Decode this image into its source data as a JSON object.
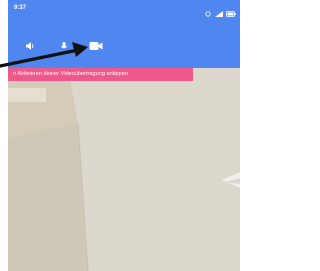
{
  "status_bar": {
    "time": "9:37"
  },
  "toolbar": {
    "icons": [
      "speaker-icon",
      "microphone-icon",
      "video-camera-icon"
    ]
  },
  "banner": {
    "text": "n Aktivieren deiner Videoübertragung antippen"
  },
  "colors": {
    "appbar": "#4f86f0",
    "banner": "#f0578a"
  }
}
